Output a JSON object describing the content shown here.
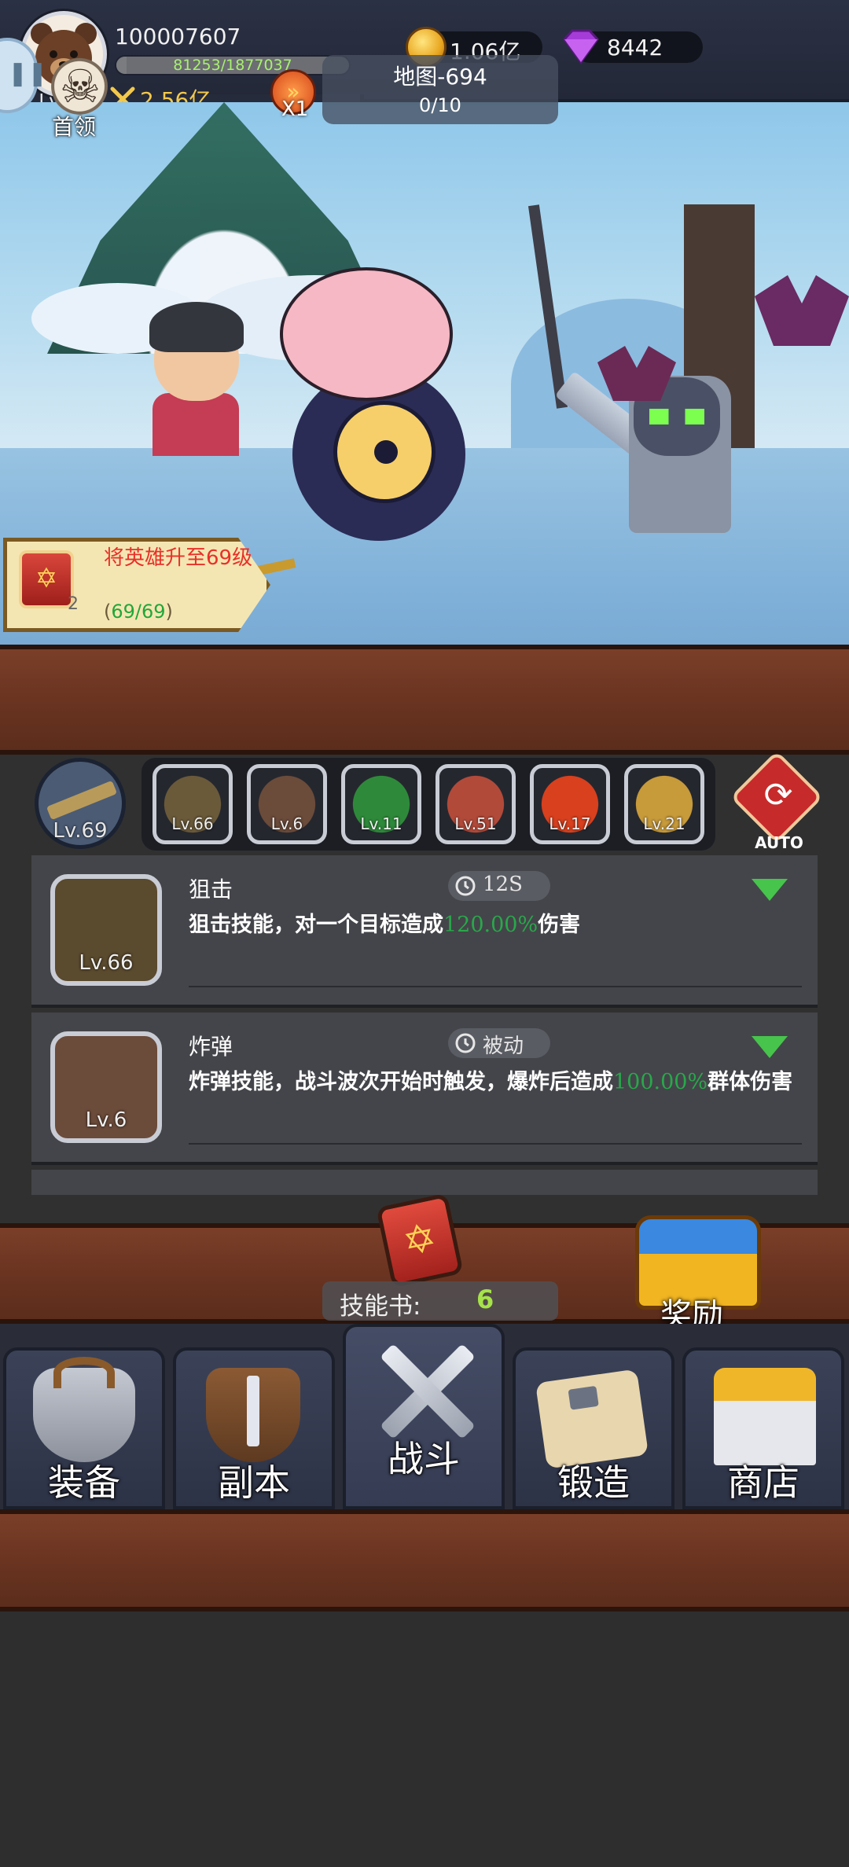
{
  "header": {
    "player_id": "100007607",
    "level": "Lv.69",
    "xp_text": "81253/1877037",
    "xp_fraction": 0.0433,
    "power": "2.56亿",
    "gold": "1.06亿",
    "gems": "8442"
  },
  "battle": {
    "boss_label": "首领",
    "speed": "X1",
    "map_name": "地图-694",
    "wave_progress": "0/10"
  },
  "quest": {
    "title": "将英雄升至69级",
    "progress_open": "(",
    "progress": "69/69",
    "progress_close": ")",
    "reward_count": "2"
  },
  "skill_slots": {
    "hero_level": "Lv.69",
    "slots": [
      {
        "level": "Lv.66",
        "color": "#6a5a3a"
      },
      {
        "level": "Lv.6",
        "color": "#6b4b3a"
      },
      {
        "level": "Lv.11",
        "color": "#2e8a3a"
      },
      {
        "level": "Lv.51",
        "color": "#b24a3a"
      },
      {
        "level": "Lv.17",
        "color": "#d8401e"
      },
      {
        "level": "Lv.21",
        "color": "#c79a3a"
      }
    ],
    "auto_label": "AUTO"
  },
  "skills": [
    {
      "name": "狙击",
      "cooldown": "12S",
      "level": "Lv.66",
      "desc_before": "狙击技能，对一个目标造成",
      "desc_value": "120.00%",
      "desc_after": "伤害"
    },
    {
      "name": "炸弹",
      "cooldown": "被动",
      "level": "Lv.6",
      "desc_before": "炸弹技能，战斗波次开始时触发，爆炸后造成",
      "desc_value": "100.00%",
      "desc_after": "群体伤害"
    }
  ],
  "skill_book": {
    "label": "技能书:",
    "count": "6"
  },
  "reward": {
    "label": "奖励"
  },
  "nav": {
    "tabs": [
      {
        "label": "装备",
        "icon": "helmet-icon"
      },
      {
        "label": "副本",
        "icon": "sword-shield-icon"
      },
      {
        "label": "战斗",
        "icon": "crossed-swords-icon"
      },
      {
        "label": "锻造",
        "icon": "scroll-hammer-icon"
      },
      {
        "label": "商店",
        "icon": "shop-icon"
      }
    ],
    "active": "战斗"
  }
}
